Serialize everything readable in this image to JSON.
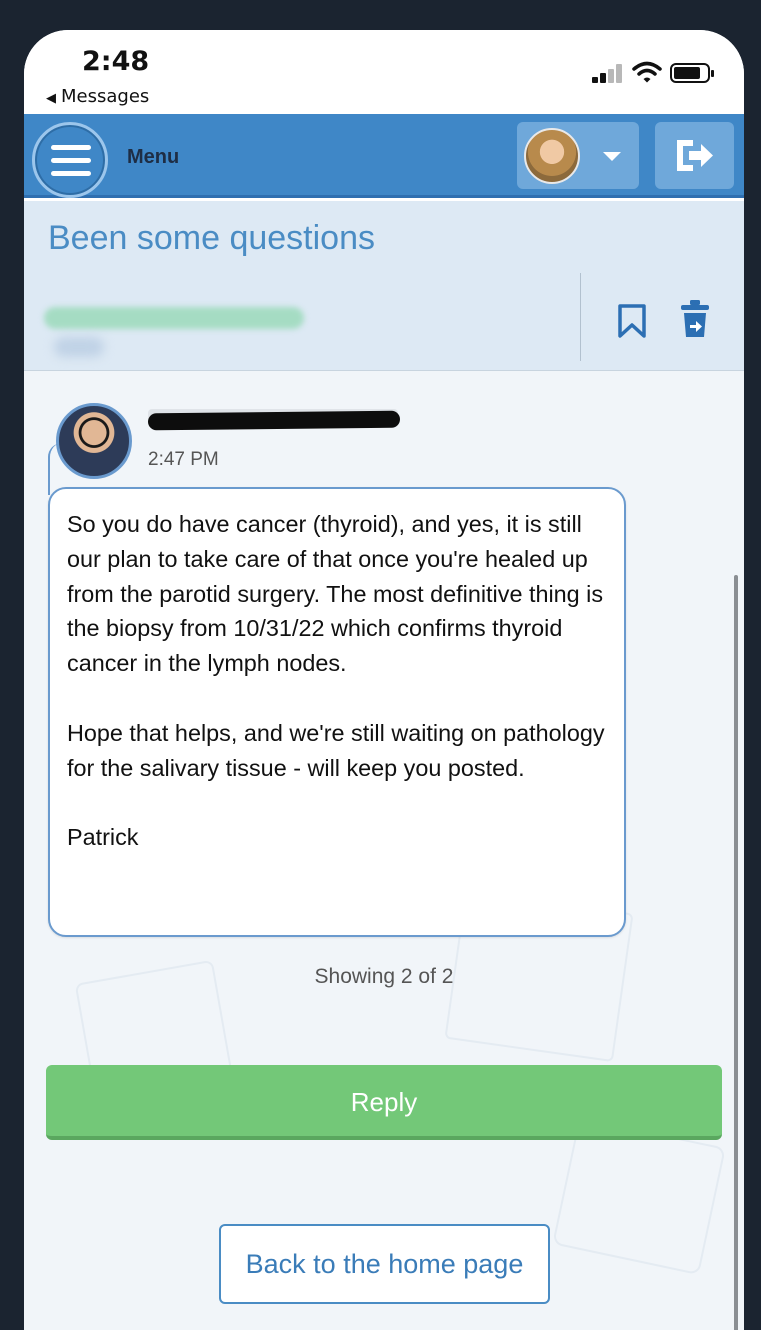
{
  "status_bar": {
    "time": "2:48",
    "back_label": "Messages"
  },
  "header": {
    "menu_label": "Menu",
    "accent_color": "#3f87c7"
  },
  "message_header": {
    "subject": "Been some questions"
  },
  "message": {
    "time": "2:47 PM",
    "paragraphs": [
      "So you do have cancer (thyroid), and yes, it is still our plan to take care of that once you're healed up from the parotid surgery. The most definitive thing is the biopsy from 10/31/22 which confirms thyroid cancer in the lymph nodes.",
      "Hope that helps, and we're still waiting on pathology for the salivary tissue - will keep you posted.",
      "Patrick"
    ]
  },
  "pagination": {
    "text": "Showing 2 of 2"
  },
  "actions": {
    "reply_label": "Reply",
    "reply_color": "#73c878",
    "home_label": "Back to the home page"
  },
  "icons": {
    "menu": "hamburger-icon",
    "logout": "logout-icon",
    "bookmark": "bookmark-icon",
    "delete": "trash-icon"
  }
}
